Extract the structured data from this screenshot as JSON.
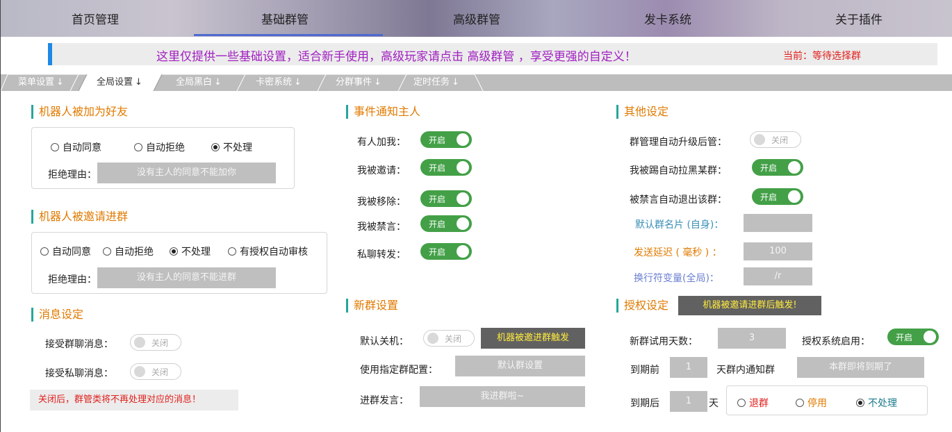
{
  "nav": {
    "items": [
      "首页管理",
      "基础群管",
      "高级群管",
      "发卡系统",
      "关于插件"
    ]
  },
  "banner": {
    "message": "这里仅提供一些基础设置，适合新手使用，高级玩家请点击 高级群管 ，享受更强的自定义！",
    "current": "当前：等待选择群"
  },
  "tabs": [
    "菜单设置",
    "全局设置",
    "全局黑白",
    "卡密系统",
    "分群事件",
    "定时任务"
  ],
  "tab_arrow": "↓",
  "friend": {
    "title": "机器人被加为好友",
    "options": [
      "自动同意",
      "自动拒绝",
      "不处理"
    ],
    "selected": 2,
    "reason_label": "拒绝理由：",
    "reason_value": "没有主人的同意不能加你"
  },
  "invite": {
    "title": "机器人被邀请进群",
    "options": [
      "自动同意",
      "自动拒绝",
      "不处理",
      "有授权自动审核"
    ],
    "selected": 2,
    "reason_label": "拒绝理由：",
    "reason_value": "没有主人的同意不能进群"
  },
  "message": {
    "title": "消息设定",
    "group_label": "接受群聊消息：",
    "private_label": "接受私聊消息：",
    "off_text": "关闭",
    "warning": "关闭后，群管类将不再处理对应的消息！"
  },
  "notify": {
    "title": "事件通知主人",
    "items": [
      "有人加我：",
      "我被邀请：",
      "我被移除：",
      "我被禁言：",
      "私聊转发："
    ],
    "on_text": "开启"
  },
  "newgroup": {
    "title": "新群设置",
    "default_off_label": "默认关机：",
    "off_text": "关闭",
    "trigger_btn": "机器被邀进群触发",
    "config_label": "使用指定群配置：",
    "config_value": "默认群设置",
    "speech_label": "进群发言：",
    "speech_value": "我进群啦~"
  },
  "other": {
    "title": "其他设定",
    "upgrade_label": "群管理自动升级后管：",
    "kick_label": "我被踢自动拉黑某群：",
    "mute_label": "被禁言自动退出该群：",
    "card_label": "默认群名片 (自身)：",
    "card_value": "",
    "delay_label": "发送延迟 ( 毫秒 ) ：",
    "delay_value": "100",
    "newline_label": "换行符变量(全局)：",
    "newline_value": "/r",
    "on_text": "开启",
    "off_text": "关闭"
  },
  "auth": {
    "title": "授权设定",
    "trigger_btn": "机器被邀请进群后触发!",
    "trial_label": "新群试用天数：",
    "trial_value": "3",
    "enable_label": "授权系统启用：",
    "on_text": "开启",
    "before_label": "到期前",
    "before_value": "1",
    "notify_label": "天群内通知群",
    "notify_value": "本群即将到期了",
    "after_label": "到期后",
    "after_value": "1",
    "day_label": "天",
    "after_options": [
      "退群",
      "停用",
      "不处理"
    ],
    "after_selected": 2
  },
  "colors": {
    "accent_blue": "#1e88e5",
    "toggle_green": "#43a047",
    "title_orange": "#e07a00",
    "warn_red": "#e0201b",
    "purple_msg": "#a020c0"
  }
}
